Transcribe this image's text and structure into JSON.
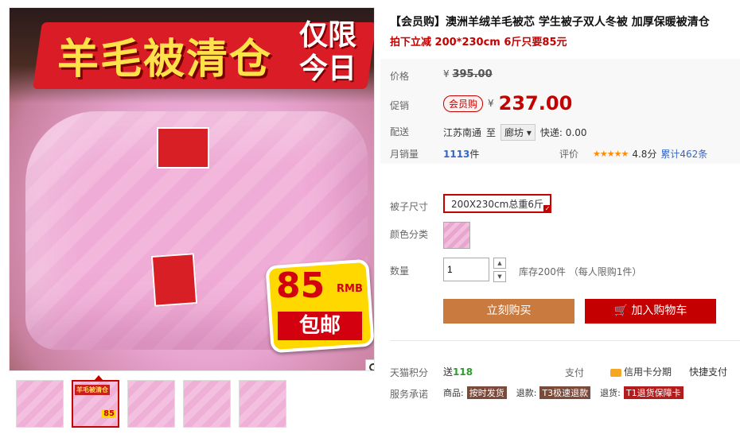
{
  "gallery": {
    "banner_main": "羊毛被清仓",
    "banner_limited": "仅限",
    "banner_today": "今日",
    "badge_price": "85",
    "badge_unit": "RMB",
    "badge_ribbon": "包邮",
    "thumbs": [
      {
        "label": ""
      },
      {
        "label": "羊毛被清仓",
        "price": "85"
      },
      {
        "label": ""
      },
      {
        "label": ""
      },
      {
        "label": ""
      }
    ]
  },
  "product": {
    "title": "【会员购】澳洲羊绒羊毛被芯 学生被子双人冬被 加厚保暖被清仓",
    "subtitle": "拍下立减 200*230cm 6斤只要85元"
  },
  "price": {
    "original_label": "价格",
    "currency": "¥",
    "original": "395.00",
    "promo_label": "促销",
    "promo_badge": "会员购",
    "promo": "237.00",
    "ship_label": "配送",
    "ship_from": "江苏南通",
    "ship_to_word": "至",
    "ship_dest": "廊坊",
    "ship_fee": "快递: 0.00",
    "sales_label": "月销量",
    "sales_count": "1113",
    "sales_unit": "件",
    "rating_label": "评价",
    "rating_stars": "★★★★★",
    "rating_score": "4.8分",
    "rating_count": "累计462条"
  },
  "options": {
    "size_label": "被子尺寸",
    "size_value": "200X230cm总重6斤",
    "color_label": "颜色分类",
    "qty_label": "数量",
    "qty_value": "1",
    "stock": "库存200件 （每人限购1件）"
  },
  "actions": {
    "buy": "立刻购买",
    "cart": "加入购物车"
  },
  "footer": {
    "points_label": "天猫积分",
    "points_prefix": "送",
    "points_value": "118",
    "pay_label": "支付",
    "card_label": "信用卡分期",
    "quick_pay": "快捷支付",
    "service_label": "服务承诺",
    "goods_label": "商品:",
    "goods_badge": "按时发货",
    "refund_label": "退款:",
    "refund_badge": "T3极速退款",
    "return_label": "退货:",
    "return_badge": "T1退货保障卡"
  },
  "colors": {
    "accent": "#c40000",
    "buy_button": "#c97b3f",
    "badge_yellow": "#ffd800"
  }
}
